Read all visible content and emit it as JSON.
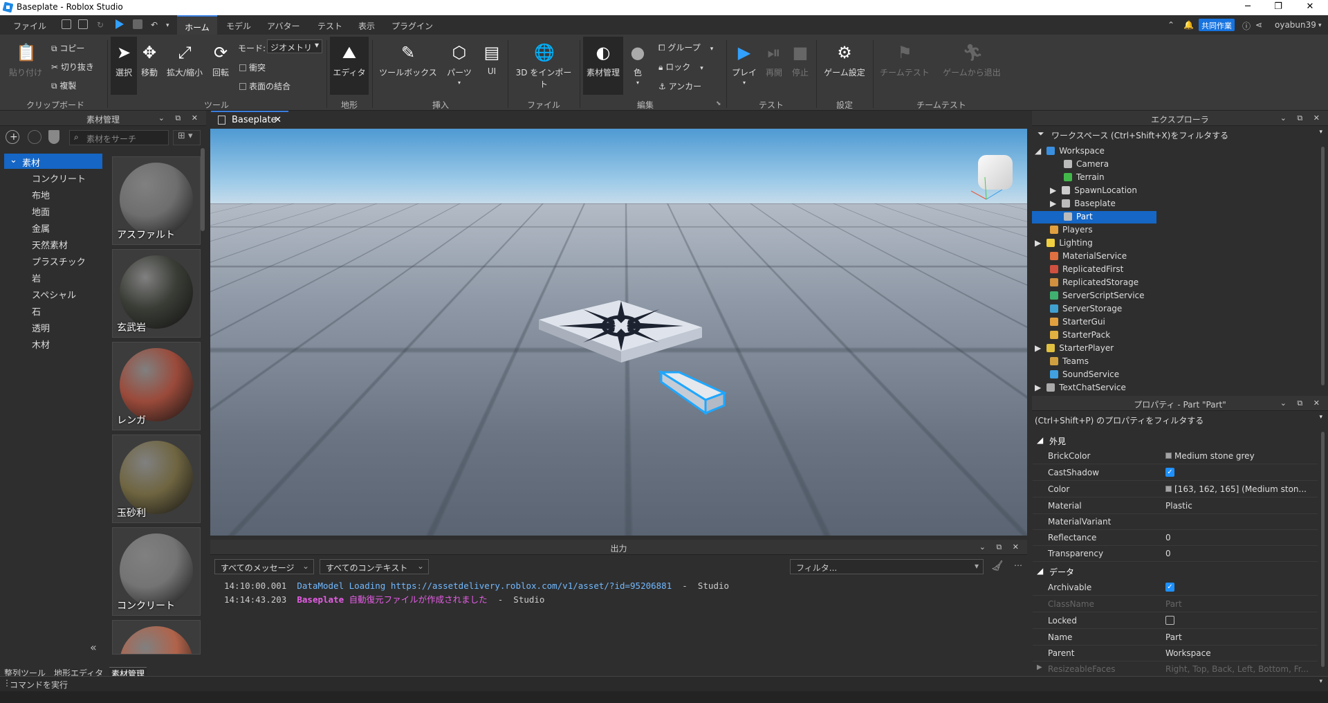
{
  "window": {
    "title": "Baseplate - Roblox Studio"
  },
  "menu": {
    "items": [
      "ファイル",
      "ホーム",
      "モデル",
      "アバター",
      "テスト",
      "表示",
      "プラグイン"
    ],
    "active": "ホーム",
    "collab": "共同作業",
    "user": "oyabun39"
  },
  "ribbon": {
    "paste": "貼り付け",
    "copy": "コピー",
    "cut": "切り抜き",
    "duplicate": "複製",
    "select": "選択",
    "move": "移動",
    "scale": "拡大/縮小",
    "rotate": "回転",
    "mode_label": "モード:",
    "mode_value": "ジオメトリ",
    "collide": "衝突",
    "join": "表面の結合",
    "editor": "エディタ",
    "toolbox": "ツールボックス",
    "parts": "パーツ",
    "ui": "UI",
    "import3d": "3D をインポート",
    "material_manager": "素材管理",
    "color": "色",
    "group": "グループ",
    "lock": "ロック",
    "anchor": "アンカー",
    "play": "プレイ",
    "resume": "再開",
    "stop": "停止",
    "game_settings": "ゲーム設定",
    "team_test": "チームテスト",
    "exit_game": "ゲームから退出",
    "groups": {
      "clipboard": "クリップボード",
      "tools": "ツール",
      "terrain": "地形",
      "insert": "挿入",
      "file": "ファイル",
      "edit": "編集",
      "test": "テスト",
      "settings": "設定",
      "teamtest": "チームテスト"
    }
  },
  "materials_panel": {
    "title": "素材管理",
    "search_placeholder": "素材をサーチ",
    "root": "素材",
    "categories": [
      "コンクリート",
      "布地",
      "地面",
      "金属",
      "天然素材",
      "プラスチック",
      "岩",
      "スペシャル",
      "石",
      "透明",
      "木材"
    ],
    "tiles": [
      {
        "label": "アスファルト",
        "color": "#6e6e6e"
      },
      {
        "label": "玄武岩",
        "color": "#3a3d36"
      },
      {
        "label": "レンガ",
        "color": "#9a4a3a"
      },
      {
        "label": "玉砂利",
        "color": "#6f6541"
      },
      {
        "label": "コンクリート",
        "color": "#747474"
      },
      {
        "label": "",
        "color": "#b0634a"
      }
    ],
    "bottom_tabs": [
      "整列ツール",
      "地形エディタ",
      "素材管理"
    ]
  },
  "viewport": {
    "tab": "Baseplate"
  },
  "output": {
    "title": "出力",
    "messages_filter": "すべてのメッセージ",
    "context_filter": "すべてのコンテキスト",
    "filter_placeholder": "フィルタ...",
    "lines": [
      {
        "time": "14:10:00.001",
        "text": "DataModel Loading https://assetdelivery.roblox.com/v1/asset/?id=95206881",
        "source": "Studio"
      },
      {
        "time": "14:14:43.203",
        "name": "Baseplate",
        "text": "自動復元ファイルが作成されました",
        "source": "Studio"
      }
    ]
  },
  "explorer": {
    "title": "エクスプローラ",
    "filter": "ワークスペース (Ctrl+Shift+X)をフィルタする",
    "items": [
      {
        "label": "Workspace",
        "color": "#3a8fe0"
      },
      {
        "label": "Camera",
        "color": "#bbbbbb"
      },
      {
        "label": "Terrain",
        "color": "#43b84a"
      },
      {
        "label": "SpawnLocation",
        "color": "#cccccc"
      },
      {
        "label": "Baseplate",
        "color": "#bbbbbb"
      },
      {
        "label": "Part",
        "color": "#bbbbbb"
      },
      {
        "label": "Players",
        "color": "#e0a040"
      },
      {
        "label": "Lighting",
        "color": "#f0d040"
      },
      {
        "label": "MaterialService",
        "color": "#e07040"
      },
      {
        "label": "ReplicatedFirst",
        "color": "#d05040"
      },
      {
        "label": "ReplicatedStorage",
        "color": "#d09040"
      },
      {
        "label": "ServerScriptService",
        "color": "#40b070"
      },
      {
        "label": "ServerStorage",
        "color": "#40a0d0"
      },
      {
        "label": "StarterGui",
        "color": "#e0a040"
      },
      {
        "label": "StarterPack",
        "color": "#e0b040"
      },
      {
        "label": "StarterPlayer",
        "color": "#e0c040"
      },
      {
        "label": "Teams",
        "color": "#d0a040"
      },
      {
        "label": "SoundService",
        "color": "#40a0e0"
      },
      {
        "label": "TextChatService",
        "color": "#aaaaaa"
      }
    ]
  },
  "properties": {
    "title": "プロパティ - Part \"Part\"",
    "filter": "(Ctrl+Shift+P) のプロパティをフィルタする",
    "cat_appearance": "外見",
    "cat_data": "データ",
    "brickcolor": "Medium stone grey",
    "color": "[163, 162, 165] (Medium ston...",
    "material": "Plastic",
    "materialvariant": "",
    "reflectance": "0",
    "transparency": "0",
    "classname": "Part",
    "name": "Part",
    "parent": "Workspace",
    "resizeablefaces": "Right, Top, Back, Left, Bottom, Fr...",
    "keys": {
      "brickcolor": "BrickColor",
      "castshadow": "CastShadow",
      "color": "Color",
      "material": "Material",
      "materialvariant": "MaterialVariant",
      "reflectance": "Reflectance",
      "transparency": "Transparency",
      "archivable": "Archivable",
      "classname": "ClassName",
      "locked": "Locked",
      "name": "Name",
      "parent": "Parent",
      "resizeablefaces": "ResizeableFaces"
    }
  },
  "command": {
    "placeholder": "コマンドを実行"
  }
}
